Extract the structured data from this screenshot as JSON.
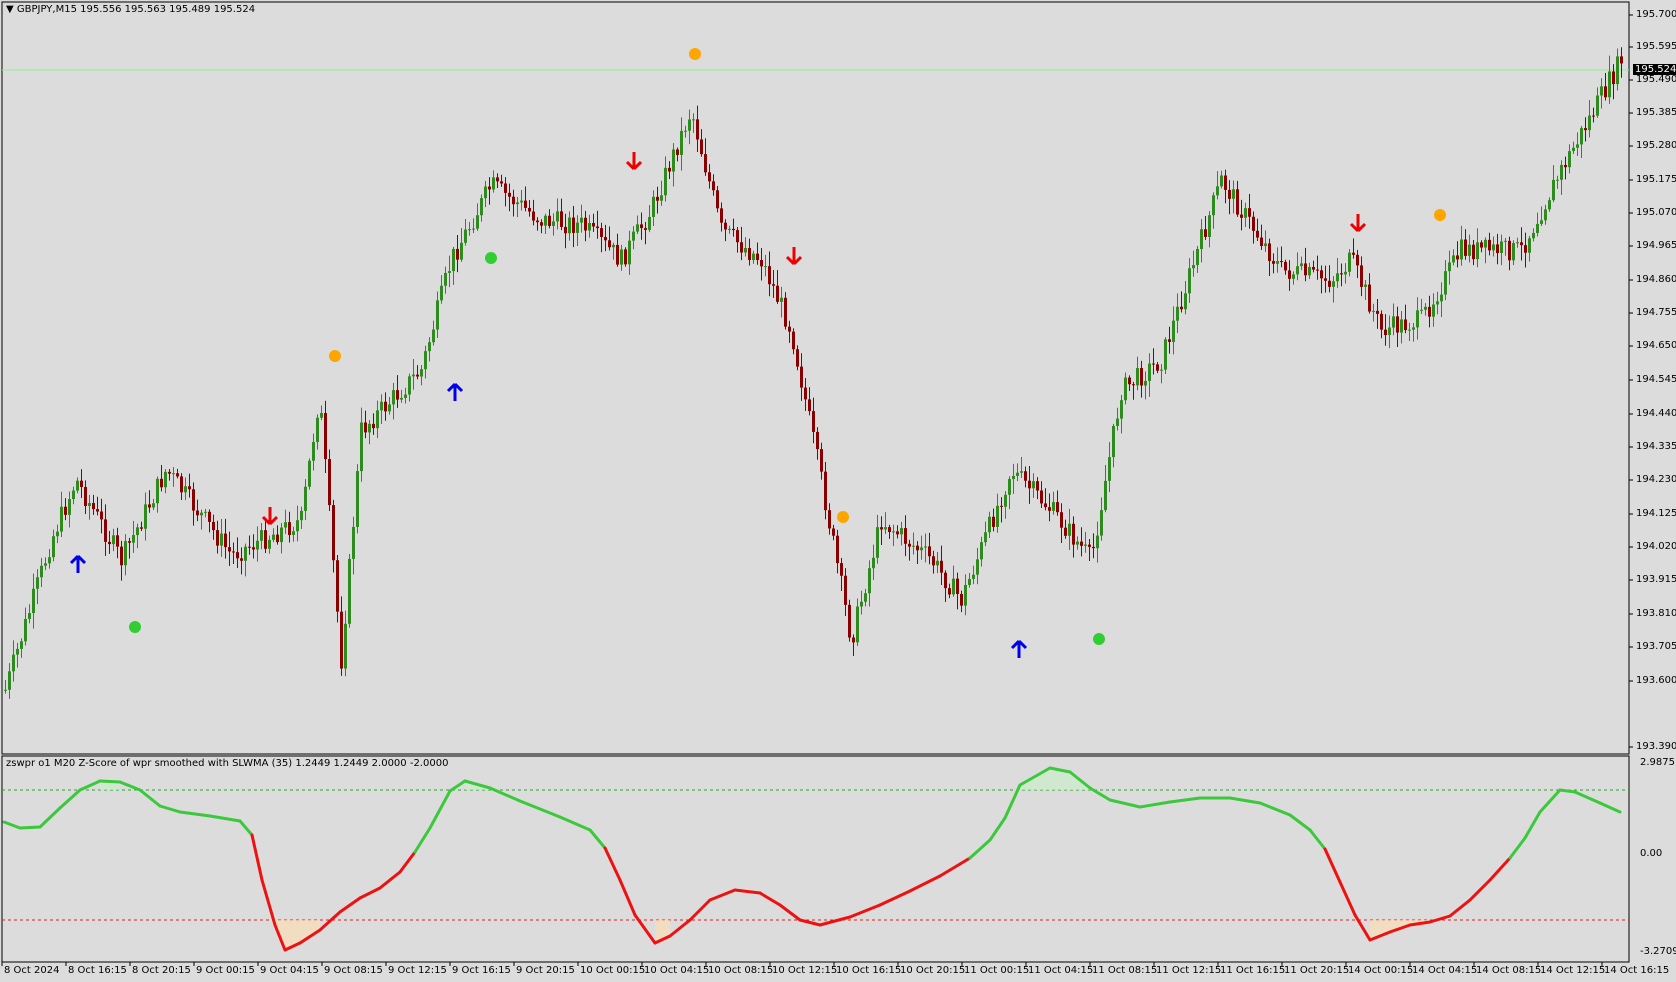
{
  "header": {
    "symbol_line": "GBPJPY,M15  195.556 195.563 195.489 195.524"
  },
  "indicator": {
    "title": "zswpr o1 M20 Z-Score of wpr smoothed with SLWMA (35) 1.2449 1.2449 2.0000 -2.0000",
    "axis_labels": [
      "2.9875",
      "0.00",
      "-3.2709"
    ],
    "upper_level": 2.0,
    "lower_level": -2.0
  },
  "price_axis": {
    "labels": [
      "195.700",
      "195.595",
      "195.490",
      "195.385",
      "195.280",
      "195.175",
      "195.070",
      "194.965",
      "194.860",
      "194.755",
      "194.650",
      "194.545",
      "194.440",
      "194.335",
      "194.230",
      "194.125",
      "194.020",
      "193.915",
      "193.810",
      "193.705",
      "193.600",
      "193.390"
    ],
    "current_price": "195.524"
  },
  "time_axis": {
    "labels": [
      "8 Oct 2024",
      "8 Oct 16:15",
      "8 Oct 20:15",
      "9 Oct 00:15",
      "9 Oct 04:15",
      "9 Oct 08:15",
      "9 Oct 12:15",
      "9 Oct 16:15",
      "9 Oct 20:15",
      "10 Oct 00:15",
      "10 Oct 04:15",
      "10 Oct 08:15",
      "10 Oct 12:15",
      "10 Oct 16:15",
      "10 Oct 20:15",
      "11 Oct 00:15",
      "11 Oct 04:15",
      "11 Oct 08:15",
      "11 Oct 12:15",
      "11 Oct 16:15",
      "11 Oct 20:15",
      "14 Oct 00:15",
      "14 Oct 04:15",
      "14 Oct 08:15",
      "14 Oct 12:15",
      "14 Oct 16:15"
    ]
  },
  "colors": {
    "background": "#dcdcdc",
    "bull": "#2e8b1e",
    "bear": "#8b0000",
    "line_up": "#3cc83c",
    "line_down": "#ee1111",
    "arrow_up": "#0000ee",
    "arrow_down": "#ee0000",
    "dot_orange": "#ffa500",
    "dot_green": "#32cd32"
  }
}
